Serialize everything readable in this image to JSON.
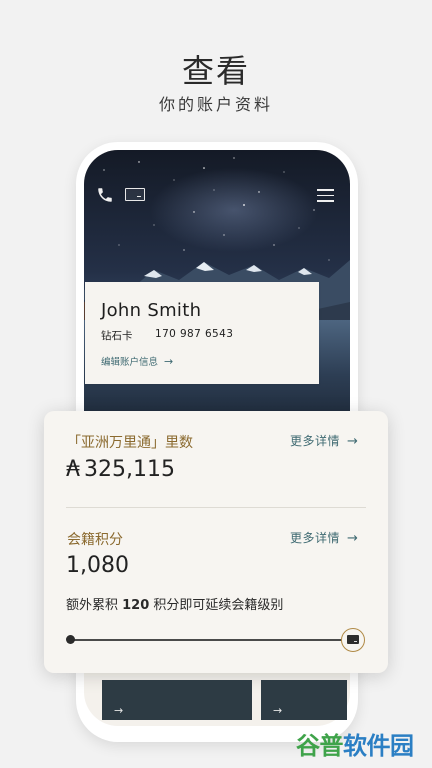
{
  "hero": {
    "title": "查看",
    "subtitle": "你的账户资料"
  },
  "top_bar": {
    "phone_icon": "phone-icon",
    "card_icon": "membership-card-icon",
    "menu_icon": "hamburger-menu-icon"
  },
  "profile": {
    "name": "John Smith",
    "tier": "钻石卡",
    "number": "170 987 6543",
    "edit_label": "编辑账户信息",
    "edit_arrow": "→"
  },
  "miles": {
    "title": "「亚洲万里通」里数",
    "more_label": "更多详情",
    "arrow": "→",
    "currency_symbol": "₳",
    "value": "325,115"
  },
  "tier_points": {
    "title": "会籍积分",
    "more_label": "更多详情",
    "arrow": "→",
    "value": "1,080",
    "note_prefix": "额外累积 ",
    "note_amount": "120",
    "note_suffix": " 积分即可延续会籍级别",
    "progress_fraction": 1.0
  },
  "tiles": {
    "arrow": "→"
  },
  "watermark": {
    "part1": "谷普",
    "part2": "软件园"
  },
  "colors": {
    "gold": "#8b6a2f",
    "teal_link": "#3f6a72",
    "tile": "#2d3b44"
  }
}
